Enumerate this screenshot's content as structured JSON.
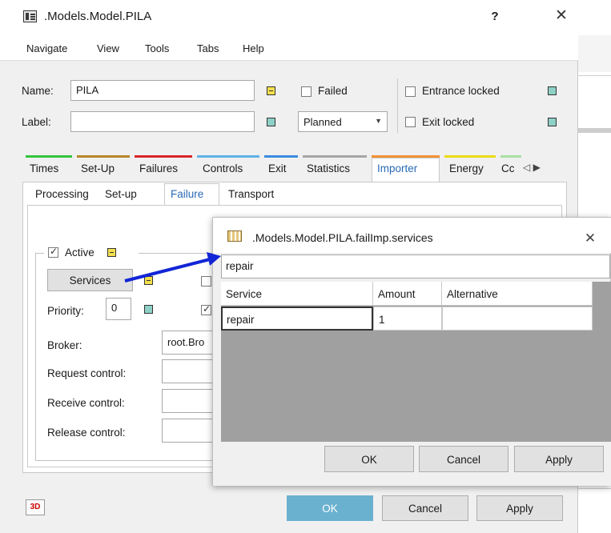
{
  "dialog": {
    "title": ".Models.Model.PILA",
    "help": "?",
    "close": "✕",
    "menu": [
      "Navigate",
      "View",
      "Tools",
      "Tabs",
      "Help"
    ],
    "name_label": "Name:",
    "name_value": "PILA",
    "label_label": "Label:",
    "label_value": "",
    "failed_label": "Failed",
    "planned_value": "Planned",
    "entrance_locked_label": "Entrance locked",
    "exit_locked_label": "Exit locked",
    "tabs": [
      "Times",
      "Set-Up",
      "Failures",
      "Controls",
      "Exit",
      "Statistics",
      "Importer",
      "Energy",
      "Cc"
    ],
    "tabs_active": "Importer",
    "tabs_scroll": "◁ ▶",
    "subtabs": [
      "Processing",
      "Set-up",
      "Failure",
      "Transport"
    ],
    "subtabs_active": "Failure",
    "active_label": "Active",
    "services_button": "Services",
    "priority_label": "Priority:",
    "priority_value": "0",
    "broker_label": "Broker:",
    "broker_value": "root.Bro",
    "request_control_label": "Request control:",
    "receive_control_label": "Receive control:",
    "release_control_label": "Release control:",
    "logo_3d": "3D",
    "ok": "OK",
    "cancel": "Cancel",
    "apply": "Apply"
  },
  "colors": {
    "tab_underlines": [
      "#33c43a",
      "#b8862a",
      "#d8252b",
      "#5fb3e6",
      "#3c8be0",
      "#a6a6a6",
      "#f29236",
      "#ecdc16",
      "#a9e0a4"
    ],
    "accent_blue": "#2a6ab6",
    "ok_button": "#6ab1cf",
    "arrow": "#1226d6"
  },
  "popup": {
    "title": ".Models.Model.PILA.failImp.services",
    "close": "✕",
    "input_value": "repair",
    "columns": [
      "Service",
      "Amount",
      "Alternative"
    ],
    "rows": [
      [
        "repair",
        "1",
        ""
      ]
    ],
    "ok": "OK",
    "cancel": "Cancel",
    "apply": "Apply"
  }
}
